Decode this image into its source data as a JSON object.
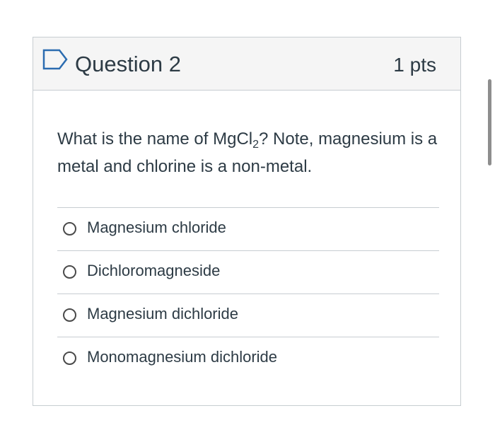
{
  "question": {
    "title": "Question 2",
    "points": "1 pts",
    "text_before_subscript": "What is the name of MgCl",
    "formula_subscript": "2",
    "text_after_subscript": "? Note, magnesium is a metal and chlorine is a non-metal."
  },
  "answers": [
    {
      "label": "Magnesium chloride"
    },
    {
      "label": "Dichloromagneside"
    },
    {
      "label": "Magnesium dichloride"
    },
    {
      "label": "Monomagnesium dichloride"
    }
  ],
  "colors": {
    "accent_flag": "#2b6cb0",
    "text": "#2d3b45",
    "border": "#c7cdd1",
    "header_bg": "#f5f5f5"
  },
  "icons": {
    "flag": "flag-outline-icon",
    "radio": "radio-unchecked-icon"
  }
}
